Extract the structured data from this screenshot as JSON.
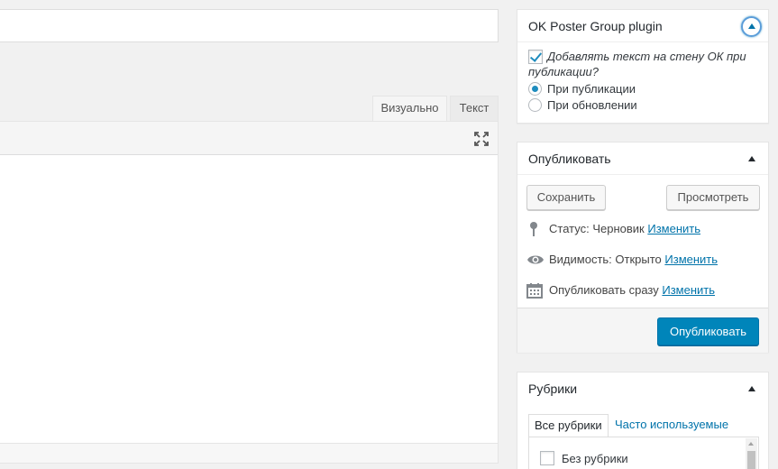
{
  "editor": {
    "title_value": "",
    "tabs": [
      {
        "label": "Визуально",
        "active": true
      },
      {
        "label": "Текст",
        "active": false
      }
    ],
    "fullscreen_icon": "fullscreen-icon"
  },
  "ok_poster": {
    "title": "OK Poster Group plugin",
    "checkbox_label_line1": "Добавлять текст на стену ОК при",
    "checkbox_label_line2": "публикации?",
    "checkbox_checked": true,
    "radio_options": [
      {
        "label": "При публикации",
        "selected": true
      },
      {
        "label": "При обновлении",
        "selected": false
      }
    ]
  },
  "publish": {
    "title": "Опубликовать",
    "save_label": "Сохранить",
    "preview_label": "Просмотреть",
    "status_label": "Статус: Черновик",
    "visibility_label": "Видимость: Открыто",
    "schedule_label": "Опубликовать сразу",
    "edit_link": "Изменить",
    "publish_label": "Опубликовать"
  },
  "categories": {
    "title": "Рубрики",
    "tab_all": "Все рубрики",
    "tab_popular": "Часто используемые",
    "items": [
      {
        "label": "Без рубрики",
        "checked": false
      }
    ]
  },
  "colors": {
    "accent": "#0073aa",
    "primary_button": "#0085ba",
    "background": "#f1f1f1"
  }
}
